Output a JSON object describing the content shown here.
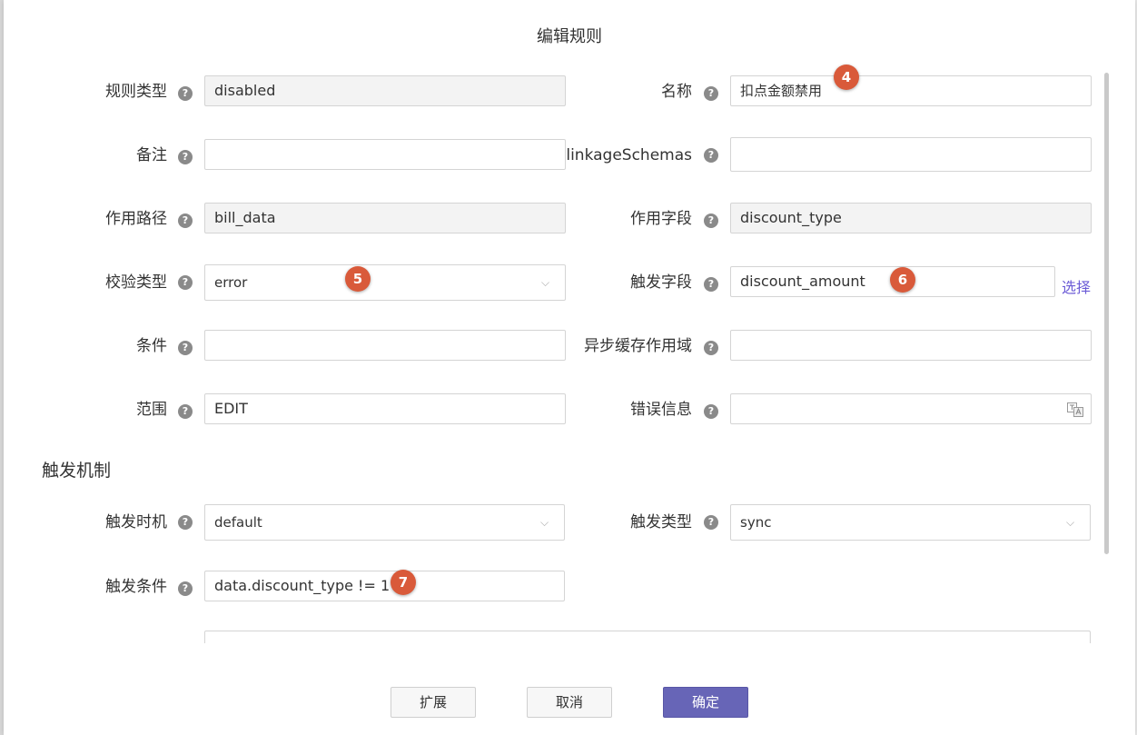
{
  "dialog": {
    "title": "编辑规则"
  },
  "form": {
    "rule_type": {
      "label": "规则类型",
      "value": "disabled"
    },
    "name": {
      "label": "名称",
      "value": "扣点金额禁用"
    },
    "remark": {
      "label": "备注",
      "value": ""
    },
    "linkage_schemas": {
      "label": "linkageSchemas",
      "value": ""
    },
    "path": {
      "label": "作用路径",
      "value": "bill_data"
    },
    "field": {
      "label": "作用字段",
      "value": "discount_type"
    },
    "validate_type": {
      "label": "校验类型",
      "value": "error"
    },
    "trigger_field": {
      "label": "触发字段",
      "value": "discount_amount",
      "select_label": "选择"
    },
    "condition": {
      "label": "条件",
      "value": ""
    },
    "async_cache_scope": {
      "label": "异步缓存作用域",
      "value": ""
    },
    "scope": {
      "label": "范围",
      "value": "EDIT"
    },
    "error_info": {
      "label": "错误信息",
      "value": ""
    }
  },
  "trigger": {
    "section_title": "触发机制",
    "timing": {
      "label": "触发时机",
      "value": "default"
    },
    "type": {
      "label": "触发类型",
      "value": "sync"
    },
    "condition": {
      "label": "触发条件",
      "value": "data.discount_type != 1"
    }
  },
  "help_icon": {
    "glyph": "?"
  },
  "chevron_glyph": "⌵",
  "badges": [
    "4",
    "5",
    "6",
    "7"
  ],
  "buttons": {
    "extend": "扩展",
    "cancel": "取消",
    "confirm": "确定"
  },
  "colors": {
    "primary": "#6765b7",
    "badge": "#d95a3a",
    "link": "#6b5bd6"
  }
}
